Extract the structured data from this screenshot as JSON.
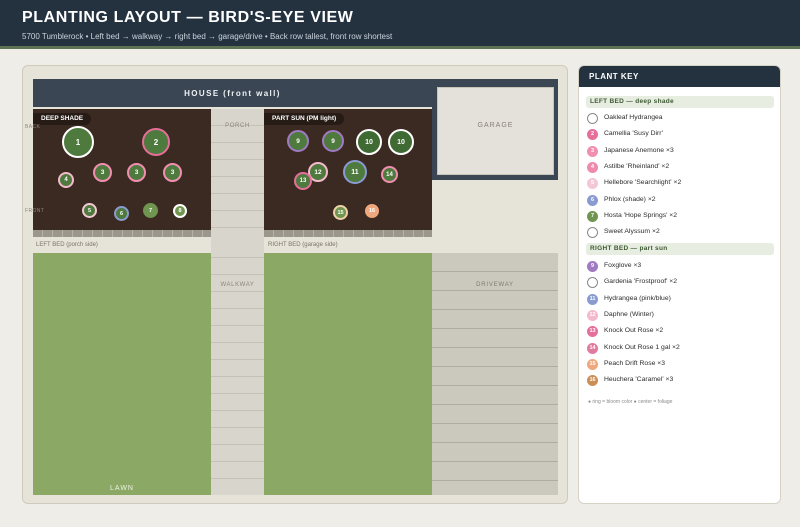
{
  "header": {
    "title": "PLANTING LAYOUT — BIRD'S-EYE VIEW",
    "subtitle": "5700 Tumblerock • Left bed → walkway → right bed → garage/drive • Back row tallest, front row shortest"
  },
  "diagram": {
    "house_label": "HOUSE (front wall)",
    "garage_label": "GARAGE",
    "porch_label": "PORCH",
    "walkway_label": "WALKWAY",
    "driveway_label": "DRIVEWAY",
    "lawn_label": "LAWN",
    "left_bed_tag": "DEEP SHADE",
    "right_bed_tag": "PART SUN (PM light)",
    "left_bed_caption": "LEFT BED (porch side)",
    "right_bed_caption": "RIGHT BED (garage side)",
    "row_back_label": "BACK",
    "row_front_label": "FRONT"
  },
  "colors": {
    "header_bg": "#243240",
    "soil": "#3b2a21",
    "lawn": "#8ca865",
    "plant_green": "#4e7a3e",
    "swatch_white": "#ffffff",
    "swatch_pink": "#e56f9a",
    "swatch_lightpink": "#f4b9cc",
    "swatch_blue": "#8a9bd1",
    "swatch_green": "#6f9550",
    "swatch_purple": "#a07ac2",
    "swatch_peach": "#efa87d",
    "swatch_tan": "#c98f56"
  },
  "plants_left": [
    {
      "id": "1",
      "ring": "#ffffff"
    },
    {
      "id": "2",
      "ring": "#e56f9a"
    },
    {
      "id": "3",
      "ring": "#f08fb0"
    },
    {
      "id": "3",
      "ring": "#f08fb0"
    },
    {
      "id": "3",
      "ring": "#f08fb0"
    },
    {
      "id": "4",
      "ring": "#f4b9cc"
    },
    {
      "id": "5",
      "ring": "#f4c7d4"
    },
    {
      "id": "6",
      "ring": "#8a9bd1"
    },
    {
      "id": "7",
      "ring": "#6f9550"
    },
    {
      "id": "8",
      "ring": "#ffffff"
    }
  ],
  "plants_right": [
    {
      "id": "9",
      "ring": "#a07ac2"
    },
    {
      "id": "9",
      "ring": "#a07ac2"
    },
    {
      "id": "10",
      "ring": "#ffffff"
    },
    {
      "id": "10",
      "ring": "#ffffff"
    },
    {
      "id": "11",
      "ring": "#8a9bd1"
    },
    {
      "id": "12",
      "ring": "#f4b9cc"
    },
    {
      "id": "13",
      "ring": "#e56f9a"
    },
    {
      "id": "14",
      "ring": "#f08fb0"
    },
    {
      "id": "15",
      "ring": "#efd1a8"
    },
    {
      "id": "16",
      "ring": "#efa87d"
    }
  ],
  "key": {
    "title": "PLANT KEY",
    "left_section": "LEFT BED — deep shade",
    "right_section": "RIGHT BED — part sun",
    "left_items": [
      {
        "num": "",
        "label": "Oakleaf Hydrangea",
        "color": "#ffffff"
      },
      {
        "num": "2",
        "label": "Camellia 'Susy Dirr'",
        "color": "#e56f9a"
      },
      {
        "num": "3",
        "label": "Japanese Anemone ×3",
        "color": "#f08fb0"
      },
      {
        "num": "4",
        "label": "Astilbe 'Rheinland' ×2",
        "color": "#ee8aae"
      },
      {
        "num": "5",
        "label": "Hellebore 'Searchlight' ×2",
        "color": "#f4c7d4"
      },
      {
        "num": "6",
        "label": "Phlox (shade) ×2",
        "color": "#8a9bd1"
      },
      {
        "num": "7",
        "label": "Hosta 'Hope Springs' ×2",
        "color": "#6f9550"
      },
      {
        "num": "",
        "label": "Sweet Alyssum ×2",
        "color": "#ffffff"
      }
    ],
    "right_items": [
      {
        "num": "9",
        "label": "Foxglove ×3",
        "color": "#a07ac2"
      },
      {
        "num": "",
        "label": "Gardenia 'Frostproof' ×2",
        "color": "#ffffff"
      },
      {
        "num": "11",
        "label": "Hydrangea (pink/blue)",
        "color": "#8a9bd1"
      },
      {
        "num": "12",
        "label": "Daphne (Winter)",
        "color": "#f4b9cc"
      },
      {
        "num": "13",
        "label": "Knock Out Rose ×2",
        "color": "#e56f9a"
      },
      {
        "num": "14",
        "label": "Knock Out Rose 1 gal ×2",
        "color": "#e27aa0"
      },
      {
        "num": "15",
        "label": "Peach Drift Rose ×3",
        "color": "#efa87d"
      },
      {
        "num": "16",
        "label": "Heuchera 'Caramel' ×3",
        "color": "#c98f56"
      }
    ],
    "note": "● ring = bloom color ● center = foliage"
  }
}
